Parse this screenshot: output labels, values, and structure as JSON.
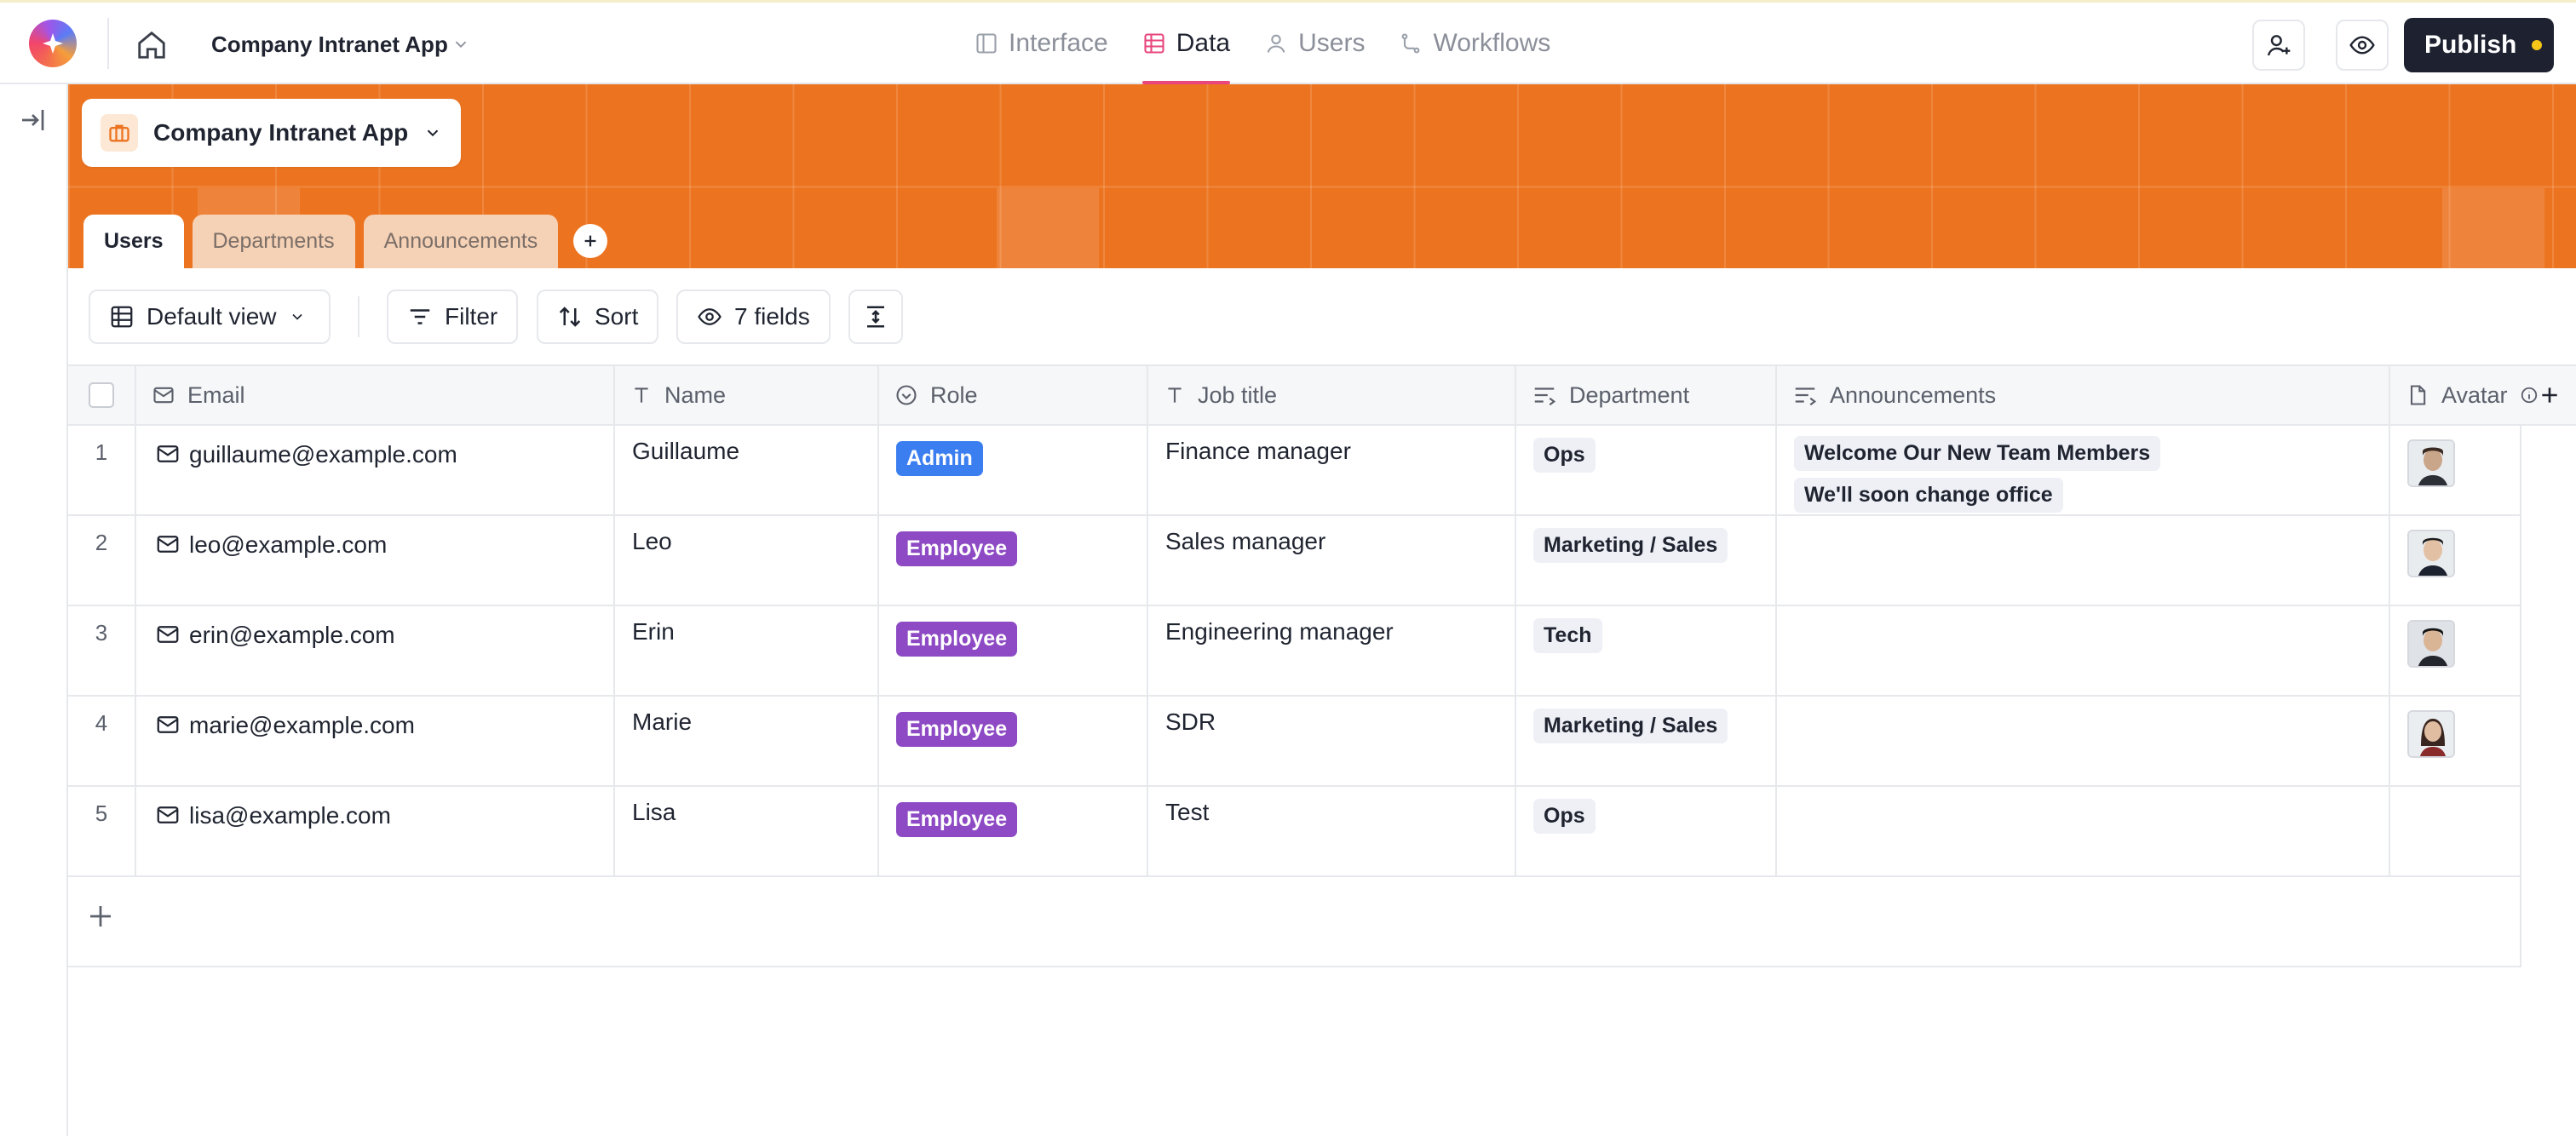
{
  "topbar": {
    "app_name": "Company Intranet App",
    "nav": [
      {
        "label": "Interface",
        "icon": "layout-icon",
        "active": false
      },
      {
        "label": "Data",
        "icon": "table-icon",
        "active": true
      },
      {
        "label": "Users",
        "icon": "user-icon",
        "active": false
      },
      {
        "label": "Workflows",
        "icon": "workflow-icon",
        "active": false
      }
    ],
    "publish_label": "Publish"
  },
  "banner": {
    "base_name": "Company Intranet App",
    "color": "#ec7420",
    "tabs": [
      {
        "label": "Users",
        "active": true
      },
      {
        "label": "Departments",
        "active": false
      },
      {
        "label": "Announcements",
        "active": false
      }
    ]
  },
  "toolbar": {
    "view_label": "Default view",
    "filter_label": "Filter",
    "sort_label": "Sort",
    "fields_label": "7 fields"
  },
  "table": {
    "columns": [
      {
        "label": "Email",
        "icon": "mail-icon"
      },
      {
        "label": "Name",
        "icon": "text-icon"
      },
      {
        "label": "Role",
        "icon": "select-icon"
      },
      {
        "label": "Job title",
        "icon": "text-icon"
      },
      {
        "label": "Department",
        "icon": "link-icon"
      },
      {
        "label": "Announcements",
        "icon": "link-icon"
      },
      {
        "label": "Avatar",
        "icon": "file-icon"
      }
    ],
    "rows": [
      {
        "num": "1",
        "email": "guillaume@example.com",
        "name": "Guillaume",
        "role": "Admin",
        "job": "Finance manager",
        "department": "Ops",
        "announcements": [
          "Welcome Our New Team Members",
          "We'll soon change office"
        ],
        "avatar": true
      },
      {
        "num": "2",
        "email": "leo@example.com",
        "name": "Leo",
        "role": "Employee",
        "job": "Sales manager",
        "department": "Marketing / Sales",
        "announcements": [],
        "avatar": true
      },
      {
        "num": "3",
        "email": "erin@example.com",
        "name": "Erin",
        "role": "Employee",
        "job": "Engineering manager",
        "department": "Tech",
        "announcements": [],
        "avatar": true
      },
      {
        "num": "4",
        "email": "marie@example.com",
        "name": "Marie",
        "role": "Employee",
        "job": "SDR",
        "department": "Marketing / Sales",
        "announcements": [],
        "avatar": true
      },
      {
        "num": "5",
        "email": "lisa@example.com",
        "name": "Lisa",
        "role": "Employee",
        "job": "Test",
        "department": "Ops",
        "announcements": [],
        "avatar": false
      }
    ]
  },
  "colors": {
    "accent": "#e8467c",
    "admin_badge": "#3b7ef0",
    "employee_badge": "#8d4ac4",
    "publish_bg": "#1e2230"
  }
}
